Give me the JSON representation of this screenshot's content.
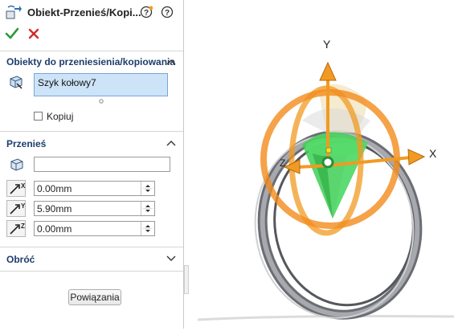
{
  "property_manager": {
    "title": "Obiekt-Przenieś/Kopi...",
    "icons": {
      "title": "move-copy-body-icon",
      "help1": "help-plus-icon",
      "help2": "help-icon",
      "ok": "checkmark-icon",
      "cancel": "close-icon"
    }
  },
  "sections": {
    "bodies": {
      "title": "Obiekty do przeniesienia/kopiowania",
      "selected_item": "Szyk kołowy7",
      "copy_label": "Kopiuj",
      "copy_checked": false
    },
    "translate": {
      "title": "Przenieś",
      "reference_value": "",
      "fields": [
        {
          "axis": "X",
          "value": "0.00mm"
        },
        {
          "axis": "Y",
          "value": "5.90mm"
        },
        {
          "axis": "Z",
          "value": "0.00mm"
        }
      ]
    },
    "rotate": {
      "title": "Obróć"
    }
  },
  "buttons": {
    "constraints_label": "Powiązania"
  },
  "viewport": {
    "axis_x": "X",
    "axis_y": "Y",
    "axis_z": "Z",
    "colors": {
      "triad_orange": "#f19a22",
      "ring_orange": "#f28b1c",
      "body_green": "#3ecf55",
      "ring_gray": "#8e9096"
    }
  }
}
